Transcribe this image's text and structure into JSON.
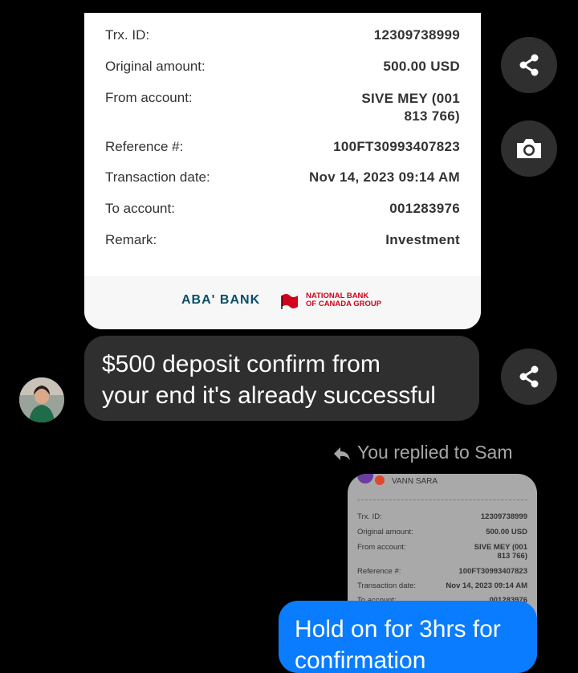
{
  "receipt": {
    "rows": [
      {
        "label": "Trx. ID:",
        "value": "12309738999"
      },
      {
        "label": "Original amount:",
        "value": "500.00 USD"
      },
      {
        "label": "From account:",
        "value_line1": "SIVE MEY (001",
        "value_line2": "813 766)"
      },
      {
        "label": "Reference #:",
        "value": "100FT30993407823"
      },
      {
        "label": "Transaction date:",
        "value": "Nov 14, 2023 09:14 AM"
      },
      {
        "label": "To account:",
        "value": "001283976"
      },
      {
        "label": "Remark:",
        "value": "Investment"
      }
    ],
    "footer": {
      "bank_name": "ABA' BANK",
      "partner_line1": "NATIONAL BANK",
      "partner_line2": "OF CANADA GROUP"
    }
  },
  "message": {
    "text_line1": "$500 deposit confirm from",
    "text_line2": "your end it's already successful"
  },
  "reply": {
    "note": "You replied to Sam",
    "preview": {
      "sender": "VANN SARA",
      "rows": [
        {
          "label": "Trx. ID:",
          "value": "12309738999"
        },
        {
          "label": "Original amount:",
          "value": "500.00 USD"
        },
        {
          "label": "From account:",
          "value_line1": "SIVE MEY (001",
          "value_line2": "813 766)"
        },
        {
          "label": "Reference #:",
          "value": "100FT30993407823"
        },
        {
          "label": "Transaction date:",
          "value": "Nov 14, 2023 09:14 AM"
        },
        {
          "label": "To account:",
          "value": "001283976"
        }
      ]
    },
    "my_message_line1": "Hold on for 3hrs for",
    "my_message_line2": "confirmation"
  },
  "icons": [
    "share-icon",
    "camera-icon",
    "reply-arrow-icon"
  ],
  "colors": {
    "bubble_dark": "#2f2f2f",
    "my_bubble": "#0a7cff",
    "aba_brand": "#0a4d68",
    "nbc_red": "#d1021a"
  }
}
